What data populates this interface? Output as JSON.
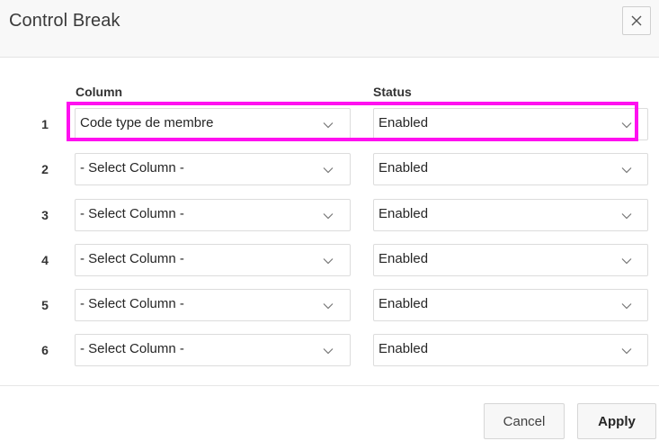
{
  "dialog": {
    "title": "Control Break",
    "close_icon": "close-icon"
  },
  "columns": {
    "column_header": "Column",
    "status_header": "Status"
  },
  "rows": [
    {
      "number": "1",
      "column": "Code type de membre",
      "status": "Enabled"
    },
    {
      "number": "2",
      "column": "- Select Column -",
      "status": "Enabled"
    },
    {
      "number": "3",
      "column": "- Select Column -",
      "status": "Enabled"
    },
    {
      "number": "4",
      "column": "- Select Column -",
      "status": "Enabled"
    },
    {
      "number": "5",
      "column": "- Select Column -",
      "status": "Enabled"
    },
    {
      "number": "6",
      "column": "- Select Column -",
      "status": "Enabled"
    }
  ],
  "footer": {
    "cancel_label": "Cancel",
    "apply_label": "Apply"
  },
  "colors": {
    "highlight": "#ff10f0",
    "header_bg": "#f8f8f8"
  }
}
